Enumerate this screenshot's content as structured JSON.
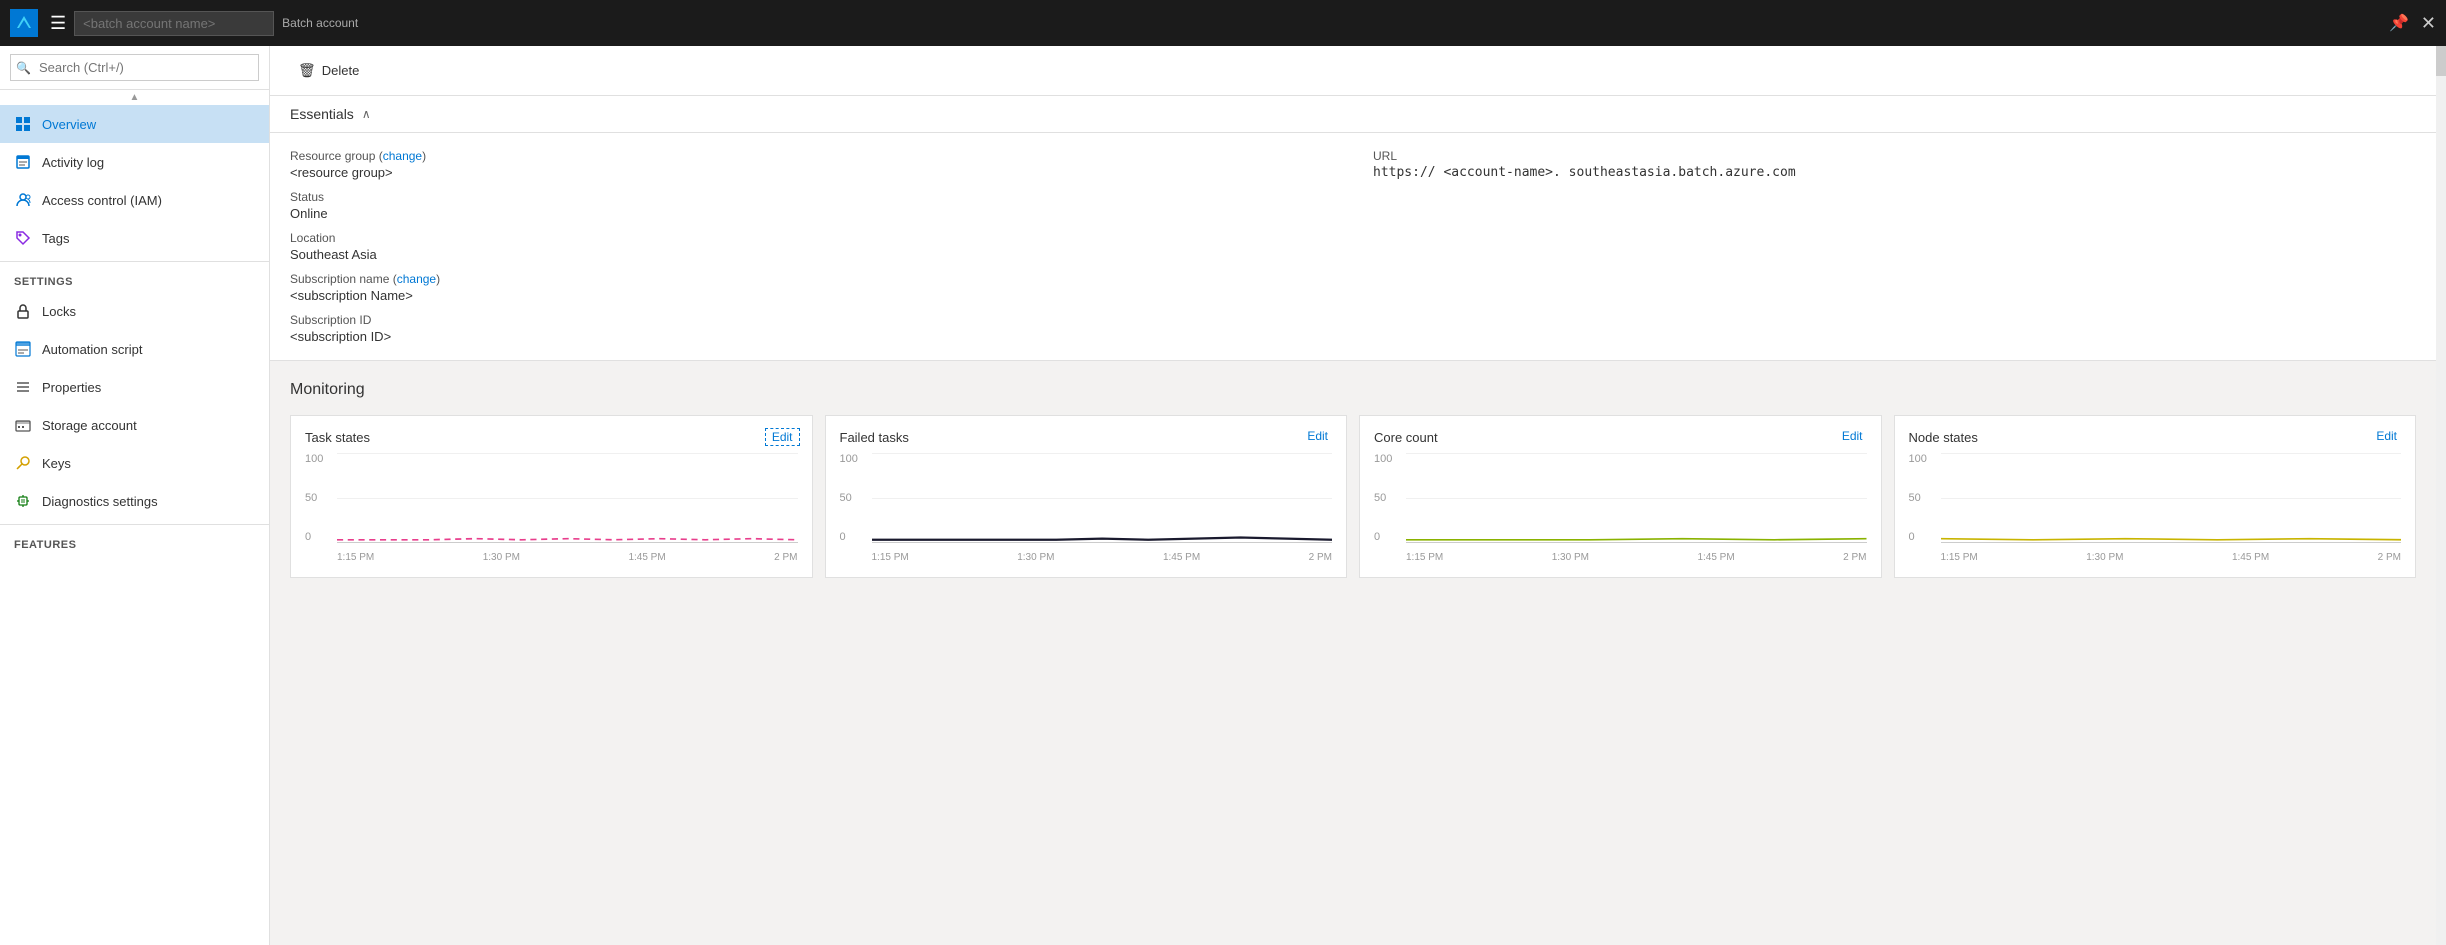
{
  "topbar": {
    "title_placeholder": "<batch account name>",
    "subtitle": "Batch account",
    "hamburger_icon": "☰",
    "pin_icon": "📌",
    "close_icon": "✕"
  },
  "sidebar": {
    "search_placeholder": "Search (Ctrl+/)",
    "items": [
      {
        "id": "overview",
        "label": "Overview",
        "icon": "⊞",
        "active": true
      },
      {
        "id": "activity-log",
        "label": "Activity log",
        "icon": "📋",
        "active": false
      },
      {
        "id": "access-control",
        "label": "Access control (IAM)",
        "icon": "👤",
        "active": false
      },
      {
        "id": "tags",
        "label": "Tags",
        "icon": "🏷",
        "active": false
      }
    ],
    "settings_label": "SETTINGS",
    "settings_items": [
      {
        "id": "locks",
        "label": "Locks",
        "icon": "🔒",
        "active": false
      },
      {
        "id": "automation-script",
        "label": "Automation script",
        "icon": "⊞",
        "active": false
      },
      {
        "id": "properties",
        "label": "Properties",
        "icon": "≡",
        "active": false
      },
      {
        "id": "storage-account",
        "label": "Storage account",
        "icon": "▦",
        "active": false
      },
      {
        "id": "keys",
        "label": "Keys",
        "icon": "🔑",
        "active": false
      },
      {
        "id": "diagnostics-settings",
        "label": "Diagnostics settings",
        "icon": "➕",
        "active": false
      }
    ],
    "features_label": "FEATURES"
  },
  "toolbar": {
    "delete_label": "Delete",
    "delete_icon": "🗑"
  },
  "essentials": {
    "header_label": "Essentials",
    "chevron": "∧",
    "resource_group_label": "Resource group (change)",
    "resource_group_value": "<resource group>",
    "status_label": "Status",
    "status_value": "Online",
    "location_label": "Location",
    "location_value": "Southeast Asia",
    "subscription_name_label": "Subscription name (change)",
    "subscription_name_value": "<subscription Name>",
    "subscription_id_label": "Subscription ID",
    "subscription_id_value": "<subscription ID>",
    "url_label": "URL",
    "url_value": "https://  <account-name>.  southeastasia.batch.azure.com"
  },
  "monitoring": {
    "title": "Monitoring",
    "cards": [
      {
        "title": "Task states",
        "edit_label": "Edit",
        "edit_dashed": true,
        "y_labels": [
          "100",
          "50",
          "0"
        ],
        "x_labels": [
          "1:15 PM",
          "1:30 PM",
          "1:45 PM",
          "2 PM"
        ],
        "line_color": "#e83e8c",
        "line_style": "dashed"
      },
      {
        "title": "Failed tasks",
        "edit_label": "Edit",
        "edit_dashed": false,
        "y_labels": [
          "100",
          "50",
          "0"
        ],
        "x_labels": [
          "1:15 PM",
          "1:30 PM",
          "1:45 PM",
          "2 PM"
        ],
        "line_color": "#1a1a2e",
        "line_style": "solid"
      },
      {
        "title": "Core count",
        "edit_label": "Edit",
        "edit_dashed": false,
        "y_labels": [
          "100",
          "50",
          "0"
        ],
        "x_labels": [
          "1:15 PM",
          "1:30 PM",
          "1:45 PM",
          "2 PM"
        ],
        "line_color": "#8ab200",
        "line_style": "solid"
      },
      {
        "title": "Node states",
        "edit_label": "Edit",
        "edit_dashed": false,
        "y_labels": [
          "100",
          "50",
          "0"
        ],
        "x_labels": [
          "1:15 PM",
          "1:30 PM",
          "1:45 PM",
          "2 PM"
        ],
        "line_color": "#c8b400",
        "line_style": "solid"
      }
    ]
  }
}
